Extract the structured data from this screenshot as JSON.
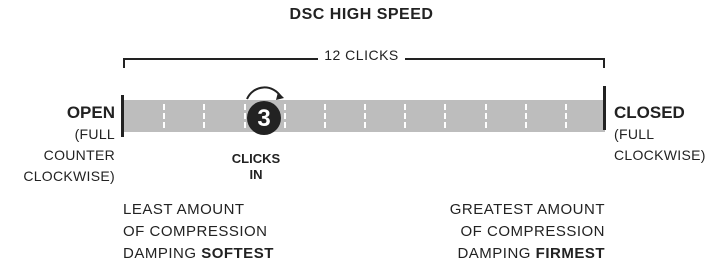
{
  "title": "DSC HIGH SPEED",
  "range_label": "12 CLICKS",
  "total_clicks": 12,
  "current_clicks": 3,
  "setting_number": "3",
  "left_end": {
    "heading": "OPEN",
    "sub_lines": [
      "(FULL",
      "COUNTER",
      "CLOCKWISE)"
    ]
  },
  "right_end": {
    "heading": "CLOSED",
    "sub_lines": [
      "(FULL",
      "CLOCKWISE)"
    ]
  },
  "marker_label_lines": [
    "CLICKS",
    "IN"
  ],
  "left_description": {
    "lines": [
      "LEAST AMOUNT",
      "OF COMPRESSION"
    ],
    "last_line_prefix": "DAMPING ",
    "last_line_emphasis": "SOFTEST"
  },
  "right_description": {
    "lines": [
      "GREATEST AMOUNT",
      "OF COMPRESSION"
    ],
    "last_line_prefix": "DAMPING ",
    "last_line_emphasis": "FIRMEST"
  },
  "colors": {
    "bar": "#bdbdbd",
    "tick": "#ffffff",
    "marker": "#222222",
    "text": "#222222"
  }
}
